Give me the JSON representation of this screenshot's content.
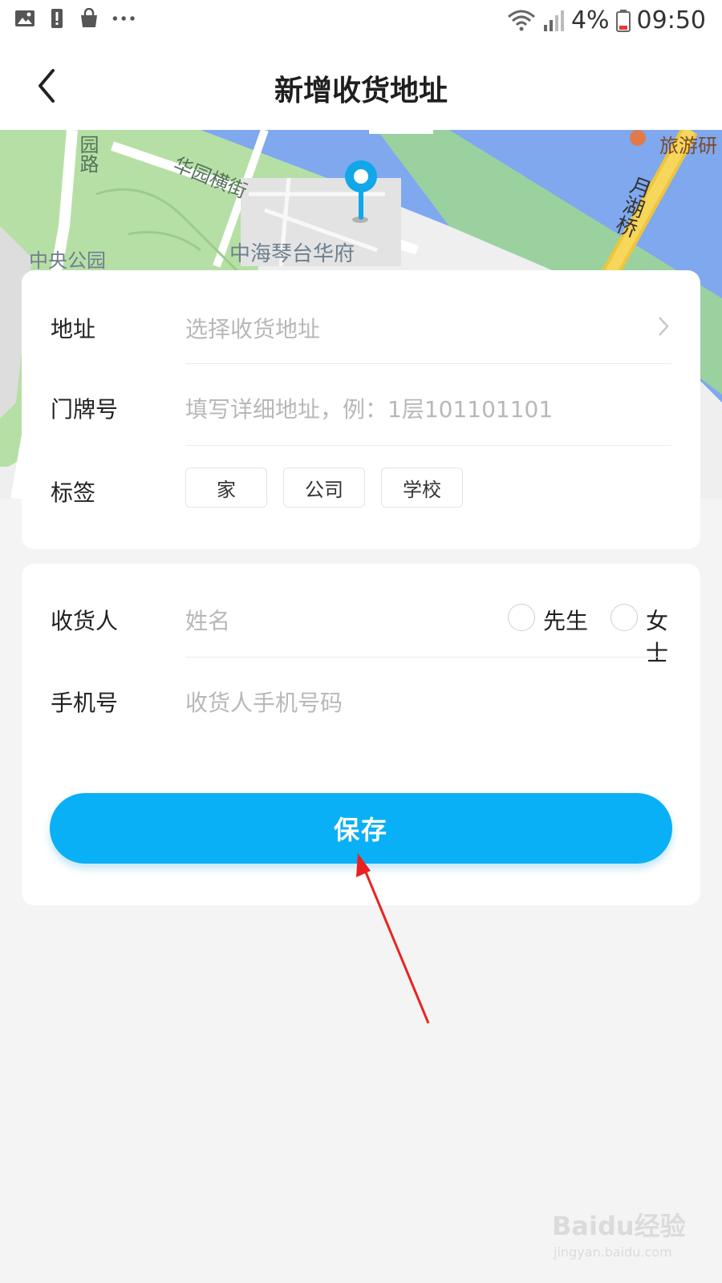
{
  "status_bar": {
    "battery_percent": "4%",
    "time": "09:50"
  },
  "header": {
    "title": "新增收货地址"
  },
  "map": {
    "labels": {
      "park": "中央公园",
      "building": "中海琴台华府",
      "street": "华园横街",
      "road": "园路",
      "bridge": "月湖桥",
      "poi": "旅游研"
    },
    "colors": {
      "water": "#7fa8ef",
      "green": "#b6dfa5",
      "pin": "#11a7e8"
    }
  },
  "address_section": {
    "address_label": "地址",
    "address_placeholder": "选择收货地址",
    "door_label": "门牌号",
    "door_placeholder": "填写详细地址，例：1层101101101",
    "tag_label": "标签",
    "tags": [
      "家",
      "公司",
      "学校"
    ]
  },
  "receiver_section": {
    "receiver_label": "收货人",
    "receiver_placeholder": "姓名",
    "gender_options": [
      "先生",
      "女士"
    ],
    "phone_label": "手机号",
    "phone_placeholder": "收货人手机号码"
  },
  "save_button": {
    "label": "保存",
    "color": "#0ab0f5"
  },
  "watermark": {
    "brand": "Baidu经验",
    "url": "jingyan.baidu.com"
  }
}
